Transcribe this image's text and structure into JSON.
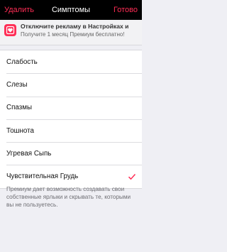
{
  "navbar": {
    "left_label": "Удалить",
    "title": "Симптомы",
    "right_label": "Готово"
  },
  "promo": {
    "icon": "heart-icon",
    "title": "Отключите рекламу в Настройках и",
    "subtitle": "Получите 1 месяц Премиум бесплатно!"
  },
  "symptoms": [
    {
      "label": "Слабость",
      "checked": false
    },
    {
      "label": "Слезы",
      "checked": false
    },
    {
      "label": "Спазмы",
      "checked": false
    },
    {
      "label": "Тошнота",
      "checked": false
    },
    {
      "label": "Угревая Сыпь",
      "checked": false
    },
    {
      "label": "Чувствительная Грудь",
      "checked": true
    }
  ],
  "footer_note": "Премиум дает возможность создавать свои собственные ярлыки и скрывать те, которыми вы не пользуетесь.",
  "colors": {
    "accent": "#ff2d55",
    "navbar_bg": "#000000",
    "page_bg": "#efeff4"
  }
}
